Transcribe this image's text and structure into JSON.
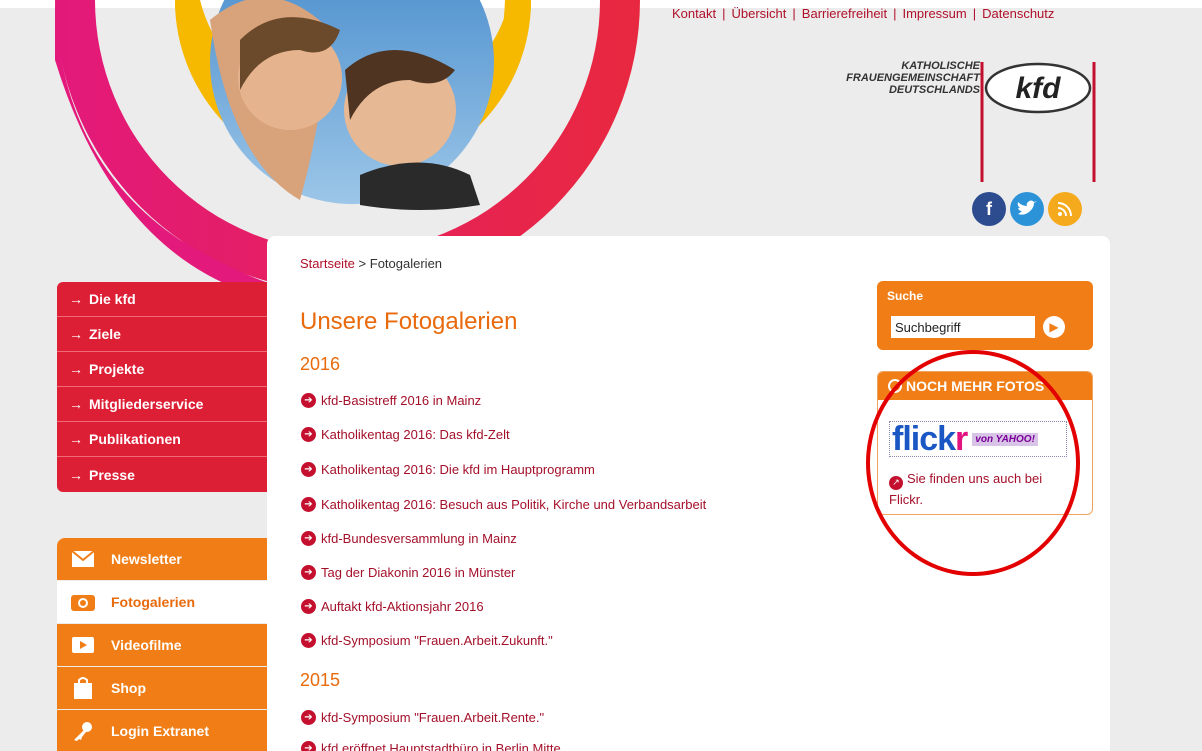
{
  "topnav": {
    "items": [
      "Kontakt",
      "Übersicht",
      "Barrierefreiheit",
      "Impressum",
      "Datenschutz"
    ]
  },
  "logo": {
    "line1": "KATHOLISCHE",
    "line2": "FRAUENGEMEINSCHAFT",
    "line3": "DEUTSCHLANDS",
    "mark": "kfd"
  },
  "social": {
    "facebook_icon": "facebook-icon",
    "twitter_icon": "twitter-icon",
    "rss_icon": "rss-icon"
  },
  "breadcrumb": {
    "home": "Startseite",
    "separator": ">",
    "current": "Fotogalerien"
  },
  "main": {
    "title": "Unsere Fotogalerien",
    "year_2016": "2016",
    "links_2016": [
      "kfd-Basistreff 2016 in Mainz",
      "Katholikentag 2016: Das kfd-Zelt",
      "Katholikentag 2016: Die kfd im Hauptprogramm",
      "Katholikentag 2016: Besuch aus Politik, Kirche und Verbandsarbeit",
      "kfd-Bundesversammlung in Mainz",
      "Tag der Diakonin 2016 in Münster",
      "Auftakt kfd-Aktionsjahr 2016",
      "kfd-Symposium \"Frauen.Arbeit.Zukunft.\""
    ],
    "year_2015": "2015",
    "links_2015": [
      "kfd-Symposium \"Frauen.Arbeit.Rente.\"",
      "kfd eröffnet Hauptstadtbüro in Berlin Mitte"
    ]
  },
  "leftnav": {
    "items": [
      "Die kfd",
      "Ziele",
      "Projekte",
      "Mitgliederservice",
      "Publikationen",
      "Presse"
    ]
  },
  "quicklinks": {
    "items": [
      "Newsletter",
      "Fotogalerien",
      "Videofilme",
      "Shop",
      "Login Extranet"
    ]
  },
  "search": {
    "label": "Suche",
    "value": "Suchbegriff"
  },
  "more_photos": {
    "header": "NOCH MEHR FOTOS",
    "flickr_word": "flick",
    "flickr_r": "r",
    "yahoo": "von YAHOO!",
    "text": "Sie finden uns auch bei Flickr."
  },
  "colors": {
    "brand_red": "#dd1f36",
    "brand_orange": "#f07d16",
    "link_red": "#a4102a",
    "annotation_red": "#e30000"
  }
}
